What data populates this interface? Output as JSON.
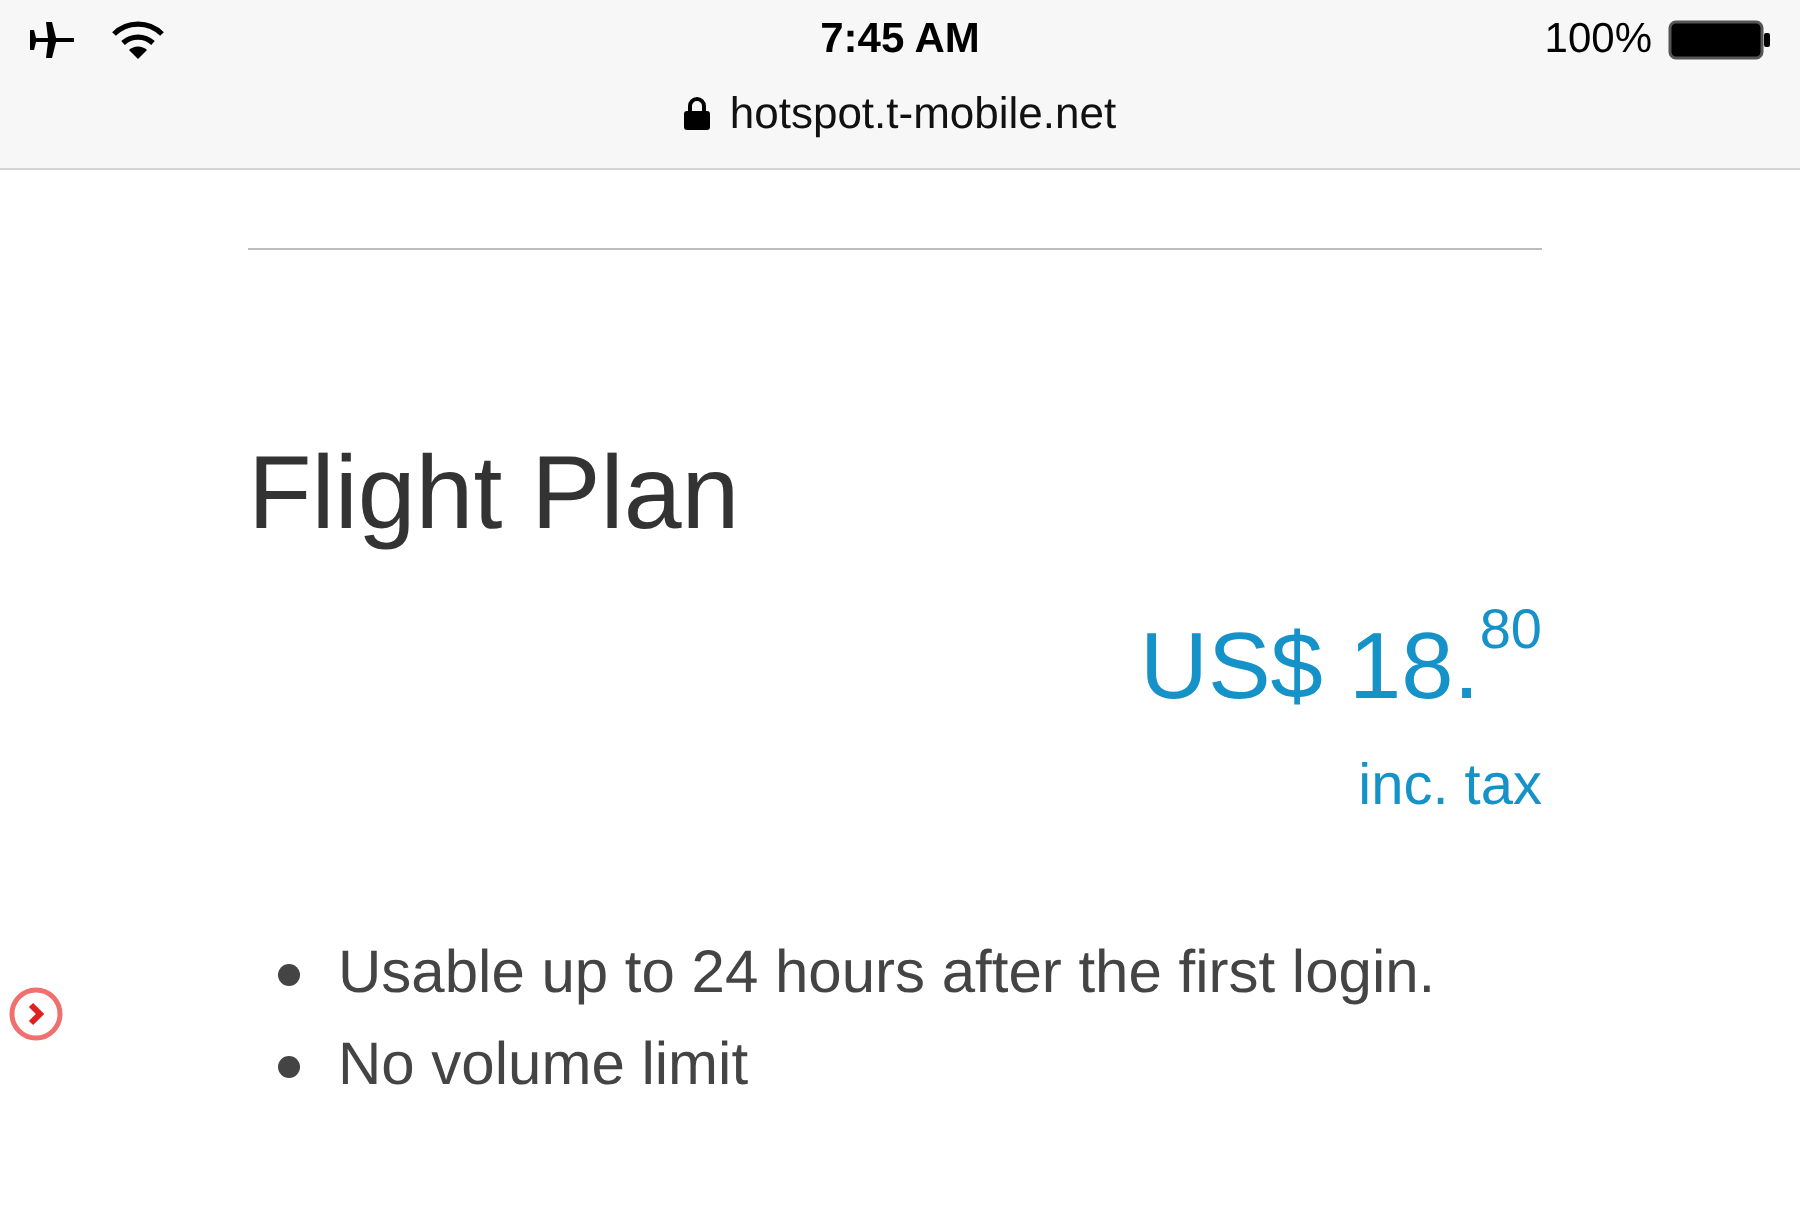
{
  "status_bar": {
    "time": "7:45 AM",
    "battery": "100%"
  },
  "address_bar": {
    "url": "hotspot.t-mobile.net"
  },
  "plan": {
    "title": "Flight Plan",
    "price": "US$ 18.$^{80}$",
    "tax_note": "inc. tax",
    "features": [
      "Usable up to 24 hours after the first login.",
      "No volume limit"
    ]
  }
}
